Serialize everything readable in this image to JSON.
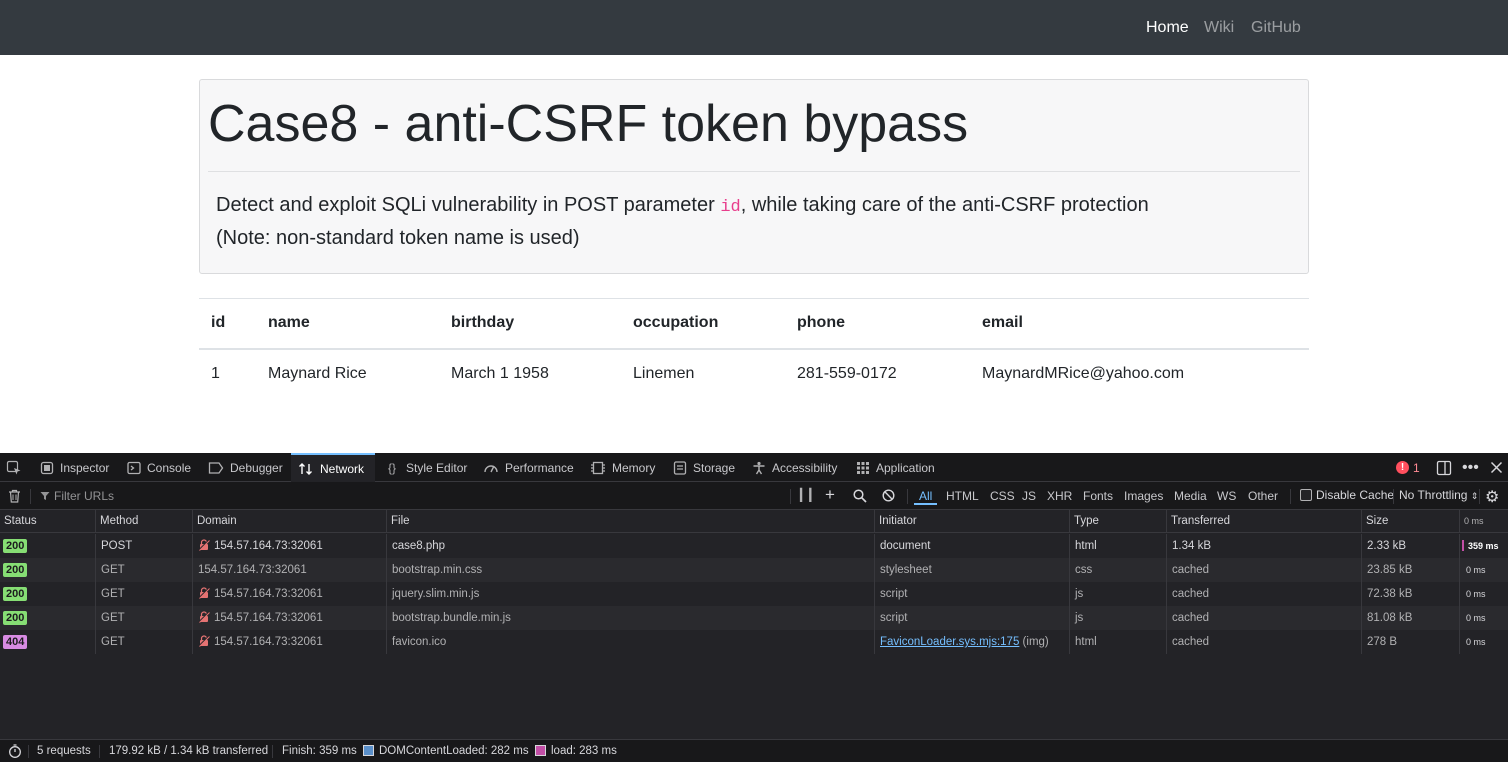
{
  "nav": {
    "items": [
      {
        "label": "Home"
      },
      {
        "label": "Wiki"
      },
      {
        "label": "GitHub"
      }
    ]
  },
  "jumbotron": {
    "title": "Case8 - anti-CSRF token bypass",
    "lead_pre": "Detect and exploit SQLi vulnerability in POST parameter ",
    "lead_code": "id",
    "lead_post": ", while taking care of the anti-CSRF protection",
    "lead_note": "(Note: non-standard token name is used)"
  },
  "table": {
    "headers": [
      "id",
      "name",
      "birthday",
      "occupation",
      "phone",
      "email"
    ],
    "rows": [
      [
        "1",
        "Maynard Rice",
        "March 1 1958",
        "Linemen",
        "281-559-0172",
        "MaynardMRice@yahoo.com"
      ]
    ]
  },
  "devtools": {
    "tabs": [
      {
        "label": "Inspector",
        "icon": "inspector-icon"
      },
      {
        "label": "Console",
        "icon": "console-icon"
      },
      {
        "label": "Debugger",
        "icon": "debugger-icon"
      },
      {
        "label": "Network",
        "icon": "network-icon"
      },
      {
        "label": "Style Editor",
        "icon": "style-editor-icon"
      },
      {
        "label": "Performance",
        "icon": "performance-icon"
      },
      {
        "label": "Memory",
        "icon": "memory-icon"
      },
      {
        "label": "Storage",
        "icon": "storage-icon"
      },
      {
        "label": "Accessibility",
        "icon": "accessibility-icon"
      },
      {
        "label": "Application",
        "icon": "application-icon"
      }
    ],
    "active_tab": "Network",
    "error_count": "1",
    "filter_placeholder": "Filter URLs",
    "type_filters": [
      "All",
      "HTML",
      "CSS",
      "JS",
      "XHR",
      "Fonts",
      "Images",
      "Media",
      "WS",
      "Other"
    ],
    "disable_cache_label": "Disable Cache",
    "throttling": "No Throttling",
    "columns": [
      "Status",
      "Method",
      "Domain",
      "File",
      "Initiator",
      "Type",
      "Transferred",
      "Size",
      "0 ms"
    ],
    "requests": [
      {
        "status": "200",
        "method": "POST",
        "domain": "154.57.164.73:32061",
        "insecure": true,
        "file": "case8.php",
        "initiator": "document",
        "initiator_link": "",
        "initiator_suffix": "",
        "type": "html",
        "transferred": "1.34 kB",
        "size": "2.33 kB",
        "time": "359 ms"
      },
      {
        "status": "200",
        "method": "GET",
        "domain": "154.57.164.73:32061",
        "insecure": false,
        "file": "bootstrap.min.css",
        "initiator": "stylesheet",
        "initiator_link": "",
        "initiator_suffix": "",
        "type": "css",
        "transferred": "cached",
        "size": "23.85 kB",
        "time": "0 ms"
      },
      {
        "status": "200",
        "method": "GET",
        "domain": "154.57.164.73:32061",
        "insecure": true,
        "file": "jquery.slim.min.js",
        "initiator": "script",
        "initiator_link": "",
        "initiator_suffix": "",
        "type": "js",
        "transferred": "cached",
        "size": "72.38 kB",
        "time": "0 ms"
      },
      {
        "status": "200",
        "method": "GET",
        "domain": "154.57.164.73:32061",
        "insecure": true,
        "file": "bootstrap.bundle.min.js",
        "initiator": "script",
        "initiator_link": "",
        "initiator_suffix": "",
        "type": "js",
        "transferred": "cached",
        "size": "81.08 kB",
        "time": "0 ms"
      },
      {
        "status": "404",
        "method": "GET",
        "domain": "154.57.164.73:32061",
        "insecure": true,
        "file": "favicon.ico",
        "initiator": "",
        "initiator_link": "FaviconLoader.sys.mjs:175",
        "initiator_suffix": " (img)",
        "type": "html",
        "transferred": "cached",
        "size": "278 B",
        "time": "0 ms"
      }
    ],
    "status_bar": {
      "requests": "5 requests",
      "transferred": "179.92 kB / 1.34 kB transferred",
      "finish": "Finish: 359 ms",
      "dom_content_loaded": "DOMContentLoaded: 282 ms",
      "load": "load: 283 ms"
    },
    "colors": {
      "status_200": "#86de74",
      "status_404": "#d88be3",
      "dcl": "#5a8fc9",
      "load": "#c24fa6",
      "accent": "#75bfff"
    }
  }
}
